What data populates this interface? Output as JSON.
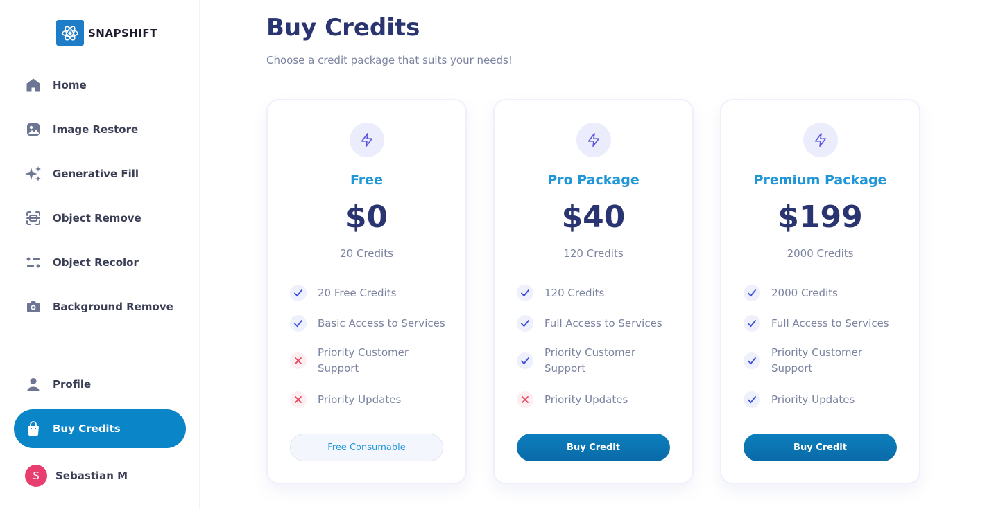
{
  "brand": {
    "name": "SNAPSHIFT",
    "color": "#1f7cc7"
  },
  "sidebar": {
    "items": [
      {
        "label": "Home",
        "icon": "home-icon"
      },
      {
        "label": "Image Restore",
        "icon": "image-icon"
      },
      {
        "label": "Generative Fill",
        "icon": "sparkles-icon"
      },
      {
        "label": "Object Remove",
        "icon": "scan-icon"
      },
      {
        "label": "Object Recolor",
        "icon": "sliders-icon"
      },
      {
        "label": "Background Remove",
        "icon": "camera-icon"
      },
      {
        "label": "Profile",
        "icon": "user-icon"
      },
      {
        "label": "Buy Credits",
        "icon": "bag-icon",
        "active": true
      }
    ],
    "user": {
      "initial": "S",
      "name": "Sebastian M"
    }
  },
  "main": {
    "title": "Buy Credits",
    "subtitle": "Choose a credit package that suits your needs!"
  },
  "cards": [
    {
      "name": "Free",
      "price": "$0",
      "credits": "20 Credits",
      "features": [
        {
          "text": "20 Free Credits",
          "included": true
        },
        {
          "text": "Basic Access to Services",
          "included": true
        },
        {
          "text": "Priority Customer Support",
          "included": false
        },
        {
          "text": "Priority Updates",
          "included": false
        }
      ],
      "button": "Free Consumable"
    },
    {
      "name": "Pro Package",
      "price": "$40",
      "credits": "120 Credits",
      "features": [
        {
          "text": "120 Credits",
          "included": true
        },
        {
          "text": "Full Access to Services",
          "included": true
        },
        {
          "text": "Priority Customer Support",
          "included": true
        },
        {
          "text": "Priority Updates",
          "included": false
        }
      ],
      "button": "Buy Credit"
    },
    {
      "name": "Premium Package",
      "price": "$199",
      "credits": "2000 Credits",
      "features": [
        {
          "text": "2000 Credits",
          "included": true
        },
        {
          "text": "Full Access to Services",
          "included": true
        },
        {
          "text": "Priority Customer Support",
          "included": true
        },
        {
          "text": "Priority Updates",
          "included": true
        }
      ],
      "button": "Buy Credit"
    }
  ],
  "colors": {
    "accent": "#0a85c8",
    "title": "#2a3470",
    "plan_name": "#1e96d8",
    "check": "#3b4fd8",
    "cross": "#e8455c"
  }
}
